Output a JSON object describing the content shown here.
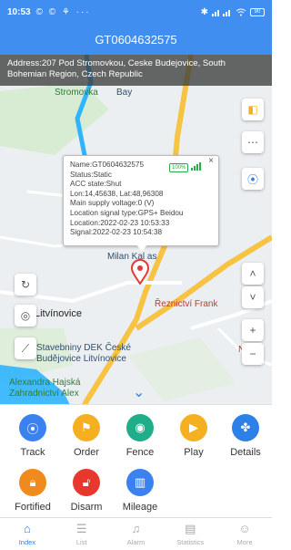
{
  "status_bar": {
    "time": "10:53",
    "left_icons": "© © ⚘ ···",
    "battery": "90"
  },
  "header": {
    "title": "GT0604632575"
  },
  "address": {
    "text": "Address:207 Pod Stromovkou, Ceske Budejovice, South Bohemian Region, Czech Republic"
  },
  "map": {
    "labels": {
      "stromovka": "Stromovka",
      "bay": "Bay",
      "milan": "Milan Kal as",
      "reznictvi": "Řeznictví Frank",
      "litvinovice": "Litvínovice",
      "dek": "Stavebniny DEK České Budějovice Litvínovice",
      "alexandra": "Alexandra Hajská Zahradnictví Alex",
      "nemo": "N"
    }
  },
  "popup": {
    "badge": "100%",
    "lines": [
      "Name:GT0604632575",
      "Status:Static",
      "ACC state:Shut",
      "Lon:14,45638, Lat:48,96308",
      "Main supply voltage:0 (V)",
      "Location signal type:GPS+ Beidou",
      "Location:2022-02-23 10:53:33",
      "Signal:2022-02-23 10:54:38"
    ],
    "close": "×"
  },
  "functions": [
    {
      "label": "Track",
      "icon": "location-icon",
      "color": "#3b82f0"
    },
    {
      "label": "Order",
      "icon": "flag-icon",
      "color": "#f5b021"
    },
    {
      "label": "Fence",
      "icon": "fence-icon",
      "color": "#1fae8a"
    },
    {
      "label": "Play",
      "icon": "play-icon",
      "color": "#f5b021"
    },
    {
      "label": "Details",
      "icon": "details-icon",
      "color": "#2d80e8"
    },
    {
      "label": "Fortified",
      "icon": "lock-icon",
      "color": "#f08a1c"
    },
    {
      "label": "Disarm",
      "icon": "unlock-icon",
      "color": "#e8372c"
    },
    {
      "label": "Mileage",
      "icon": "mileage-icon",
      "color": "#3b82f0"
    }
  ],
  "tabs": [
    {
      "label": "Index",
      "icon": "home-icon",
      "active": true
    },
    {
      "label": "List",
      "icon": "list-icon",
      "active": false
    },
    {
      "label": "Alarm",
      "icon": "alarm-icon",
      "active": false
    },
    {
      "label": "Statistics",
      "icon": "statistics-icon",
      "active": false
    },
    {
      "label": "More",
      "icon": "more-icon",
      "active": false
    }
  ]
}
